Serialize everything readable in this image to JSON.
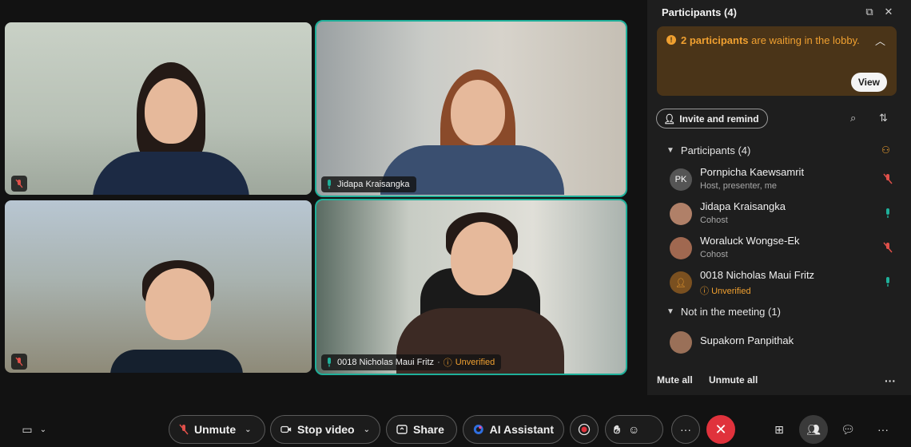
{
  "tiles": [
    {
      "name": "",
      "muted": true
    },
    {
      "name": "Jidapa Kraisangka",
      "muted": false,
      "active": true
    },
    {
      "name": "",
      "muted": true
    },
    {
      "name": "0018 Nicholas Maui Fritz",
      "status": "Unverified",
      "muted": false,
      "active": true
    }
  ],
  "panel": {
    "title": "Participants (4)",
    "lobby": {
      "count_text": "2 participants",
      "rest_text": " are waiting in the lobby.",
      "view_label": "View"
    },
    "invite_label": "Invite and remind",
    "participants_section": "Participants (4)",
    "participants": [
      {
        "initials": "PK",
        "name": "Pornpicha Kaewsamrit",
        "role": "Host, presenter, me",
        "mic": "muted",
        "avatar_color": "#5a5a5a"
      },
      {
        "initials": "",
        "name": "Jidapa Kraisangka",
        "role": "Cohost",
        "mic": "on",
        "avatar_color": "#b08068"
      },
      {
        "initials": "",
        "name": "Woraluck Wongse-Ek",
        "role": "Cohost",
        "mic": "muted",
        "avatar_color": "#a06850"
      },
      {
        "initials": "",
        "name": "0018 Nicholas Maui Fritz",
        "role": "Unverified",
        "mic": "on",
        "avatar_color": "#7a5020"
      }
    ],
    "not_in_meeting_section": "Not in the meeting (1)",
    "not_in_meeting": [
      {
        "name": "Supakorn Panpithak",
        "avatar_color": "#9a7058"
      }
    ],
    "mute_all": "Mute all",
    "unmute_all": "Unmute all"
  },
  "toolbar": {
    "unmute": "Unmute",
    "stop_video": "Stop video",
    "share": "Share",
    "ai_assistant": "AI Assistant"
  },
  "colors": {
    "accent_teal": "#1fb09a",
    "warning_orange": "#f0a030",
    "end_red": "#e0323c",
    "muted_red": "#e0504a"
  }
}
